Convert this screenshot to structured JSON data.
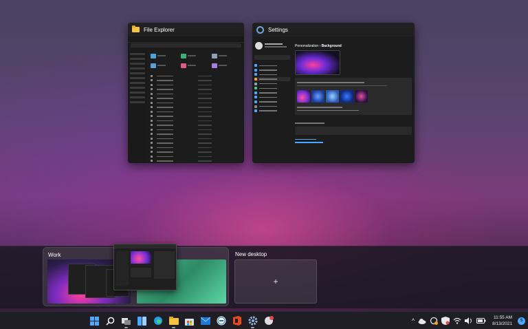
{
  "windows": {
    "explorer": {
      "title": "File Explorer"
    },
    "settings": {
      "title": "Settings",
      "breadcrumb_parent": "Personalization",
      "breadcrumb_sep": "›",
      "breadcrumb_current": "Background"
    }
  },
  "desktops": [
    {
      "label": "Work"
    },
    {
      "label": "New desktop",
      "add_glyph": "+"
    }
  ],
  "taskbar": {
    "icons": [
      "start-icon",
      "search-icon",
      "task-view-icon",
      "widgets-icon",
      "edge-icon",
      "file-explorer-icon",
      "store-icon",
      "mail-icon",
      "dell-icon",
      "office-icon",
      "settings-icon",
      "teams-icon"
    ],
    "tray": {
      "chevron": "^"
    },
    "clock": {
      "time": "11:55 AM",
      "date": "8/13/2021"
    },
    "notification_count": "5"
  },
  "colors": {
    "accent": "#4aa8ff",
    "taskbar_bg": "#1f1e24",
    "folder": "#f5c242"
  }
}
